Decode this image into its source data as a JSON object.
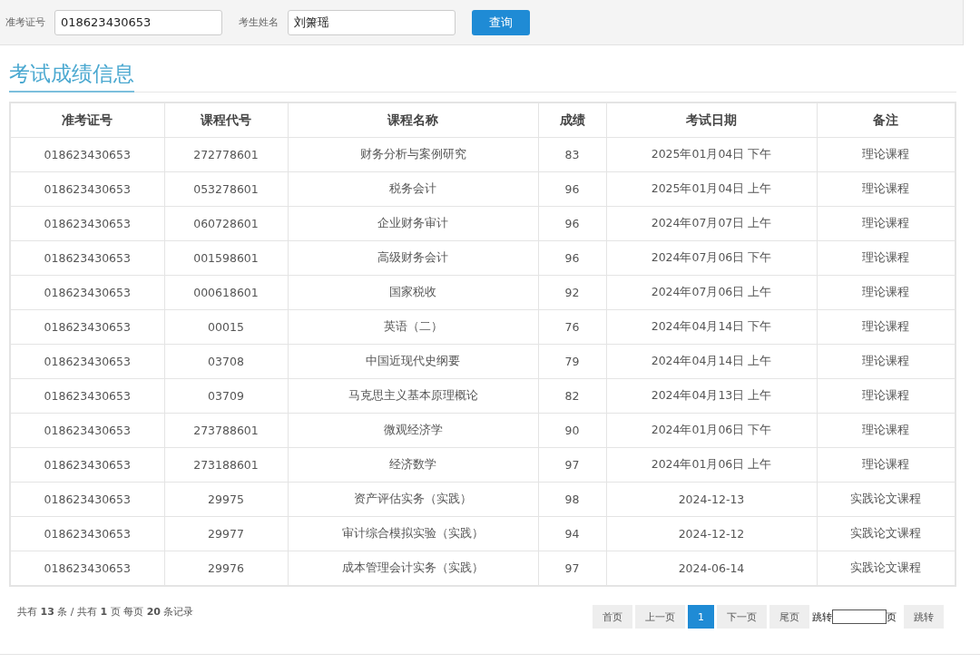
{
  "search": {
    "fields": [
      {
        "label": "准考证号",
        "value": "018623430653"
      },
      {
        "label": "考生姓名",
        "value": "刘箫瑶"
      }
    ],
    "button": "查询"
  },
  "title": "考试成绩信息",
  "table": {
    "columns": [
      "准考证号",
      "课程代号",
      "课程名称",
      "成绩",
      "考试日期",
      "备注"
    ],
    "rows": [
      [
        "018623430653",
        "272778601",
        "财务分析与案例研究",
        "83",
        "2025年01月04日 下午",
        "理论课程"
      ],
      [
        "018623430653",
        "053278601",
        "税务会计",
        "96",
        "2025年01月04日 上午",
        "理论课程"
      ],
      [
        "018623430653",
        "060728601",
        "企业财务审计",
        "96",
        "2024年07月07日 上午",
        "理论课程"
      ],
      [
        "018623430653",
        "001598601",
        "高级财务会计",
        "96",
        "2024年07月06日 下午",
        "理论课程"
      ],
      [
        "018623430653",
        "000618601",
        "国家税收",
        "92",
        "2024年07月06日 上午",
        "理论课程"
      ],
      [
        "018623430653",
        "00015",
        "英语（二）",
        "76",
        "2024年04月14日 下午",
        "理论课程"
      ],
      [
        "018623430653",
        "03708",
        "中国近现代史纲要",
        "79",
        "2024年04月14日 上午",
        "理论课程"
      ],
      [
        "018623430653",
        "03709",
        "马克思主义基本原理概论",
        "82",
        "2024年04月13日 上午",
        "理论课程"
      ],
      [
        "018623430653",
        "273788601",
        "微观经济学",
        "90",
        "2024年01月06日 下午",
        "理论课程"
      ],
      [
        "018623430653",
        "273188601",
        "经济数学",
        "97",
        "2024年01月06日 上午",
        "理论课程"
      ],
      [
        "018623430653",
        "29975",
        "资产评估实务（实践）",
        "98",
        "2024-12-13",
        "实践论文课程"
      ],
      [
        "018623430653",
        "29977",
        "审计综合模拟实验（实践）",
        "94",
        "2024-12-12",
        "实践论文课程"
      ],
      [
        "018623430653",
        "29976",
        "成本管理会计实务（实践）",
        "97",
        "2024-06-14",
        "实践论文课程"
      ]
    ]
  },
  "pagination": {
    "summary": "共有 **13** 条 / 共有 **1** 页 每页 **20** 条记录",
    "buttons": [
      {
        "label": "首页",
        "selected": false
      },
      {
        "label": "上一页",
        "selected": false
      },
      {
        "label": "1",
        "selected": true
      },
      {
        "label": "下一页",
        "selected": false
      },
      {
        "label": "尾页",
        "selected": false
      }
    ],
    "jump_label": "跳转",
    "page_unit": "页",
    "jump_button": "跳转"
  }
}
